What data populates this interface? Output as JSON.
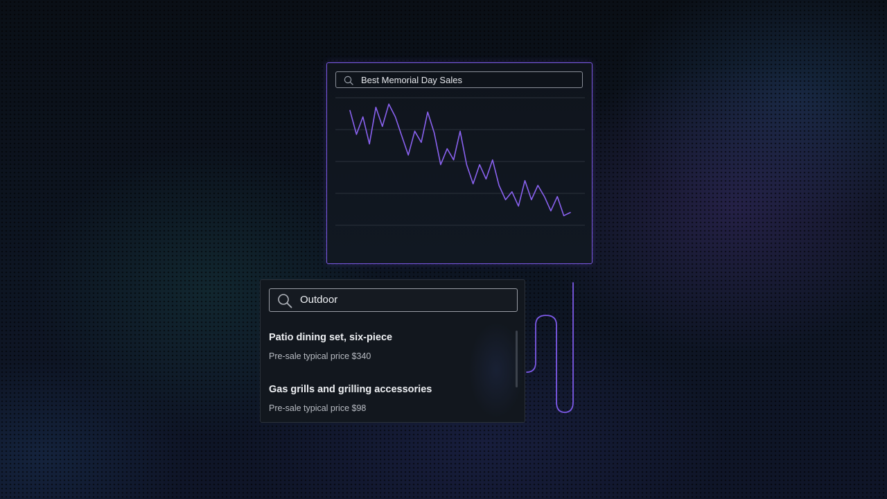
{
  "chart_panel": {
    "search_query": "Best Memorial Day Sales",
    "accent_color": "#7d5ae8",
    "icon": "search-icon"
  },
  "chart_data": {
    "type": "line",
    "title": "",
    "xlabel": "",
    "ylabel": "",
    "grid": true,
    "ylim": [
      0,
      100
    ],
    "x": [
      0,
      1,
      2,
      3,
      4,
      5,
      6,
      7,
      8,
      9,
      10,
      11,
      12,
      13,
      14,
      15,
      16,
      17,
      18,
      19,
      20,
      21,
      22,
      23,
      24,
      25,
      26,
      27,
      28,
      29,
      30,
      31,
      32,
      33,
      34
    ],
    "series": [
      {
        "values": [
          92,
          77,
          88,
          71,
          94,
          82,
          96,
          88,
          76,
          64,
          79,
          72,
          91,
          78,
          58,
          68,
          61,
          79,
          58,
          46,
          58,
          49,
          61,
          45,
          36,
          41,
          32,
          48,
          36,
          45,
          38,
          29,
          38,
          26,
          28
        ]
      }
    ]
  },
  "results_panel": {
    "search_query": "Outdoor",
    "icon": "search-icon",
    "results": [
      {
        "title": "Patio dining set, six-piece",
        "subtitle": "Pre-sale typical price $340"
      },
      {
        "title": "Gas grills and grilling accessories",
        "subtitle": "Pre-sale typical price $98"
      }
    ]
  }
}
